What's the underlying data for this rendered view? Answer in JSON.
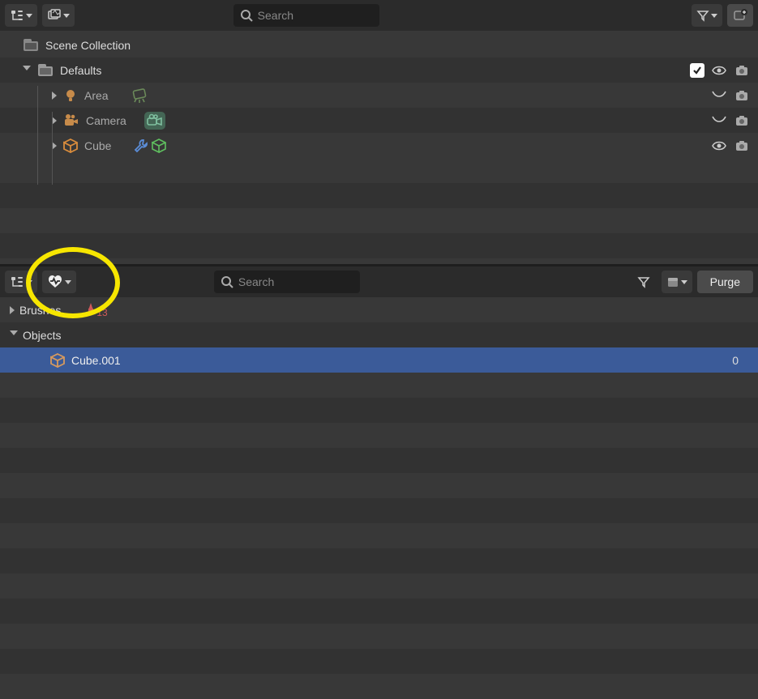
{
  "top_header": {
    "search_placeholder": "Search"
  },
  "outliner": {
    "collection_label": "Scene Collection",
    "defaults_label": "Defaults",
    "items": [
      {
        "name": "Area"
      },
      {
        "name": "Camera"
      },
      {
        "name": "Cube"
      }
    ]
  },
  "bottom_header": {
    "search_placeholder": "Search",
    "purge_label": "Purge"
  },
  "orphan": {
    "brushes_label": "Brushes",
    "brushes_count": "13",
    "objects_label": "Objects",
    "selected_item": "Cube.001",
    "selected_count": "0"
  }
}
